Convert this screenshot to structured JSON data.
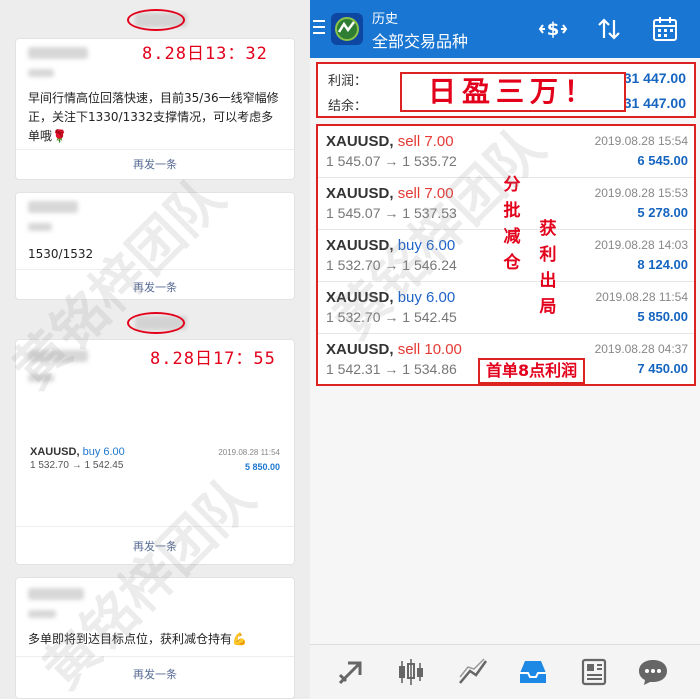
{
  "left_panel": {
    "cards": [
      {
        "timestamp": "8.28日13：32",
        "message": "早间行情高位回落快速，目前35/36一线窄幅修正，关注下1330/1332支撑情况，可以考虑多单哦🌹",
        "resend": "再发一条"
      },
      {
        "message": "1530/1532",
        "resend": "再发一条"
      },
      {
        "timestamp": "8.28日17：55",
        "trade": {
          "symbol": "XAUUSD,",
          "side": "buy 6.00",
          "date": "2019.08.28 11:54",
          "prices": "1 532.70 → 1 542.45",
          "profit": "5 850.00"
        },
        "resend": "再发一条"
      },
      {
        "message": "多单即将到达目标点位，获利减仓持有💪",
        "resend": "再发一条"
      }
    ]
  },
  "app": {
    "title_top": "历史",
    "title_main": "全部交易品种",
    "summary": {
      "profit_label": "利润：",
      "profit_value": "31 447.00",
      "balance_label": "结余：",
      "balance_value": "31 447.00",
      "overlay_text": "日盈三万！"
    },
    "trades": [
      {
        "symbol": "XAUUSD,",
        "side": "sell 7.00",
        "side_type": "sell",
        "prices": "1 545.07 → 1 535.72",
        "date": "2019.08.28 15:54",
        "profit": "6 545.00"
      },
      {
        "symbol": "XAUUSD,",
        "side": "sell 7.00",
        "side_type": "sell",
        "prices": "1 545.07 → 1 537.53",
        "date": "2019.08.28 15:53",
        "profit": "5 278.00"
      },
      {
        "symbol": "XAUUSD,",
        "side": "buy 6.00",
        "side_type": "buy",
        "prices": "1 532.70 → 1 546.24",
        "date": "2019.08.28 14:03",
        "profit": "8 124.00"
      },
      {
        "symbol": "XAUUSD,",
        "side": "buy 6.00",
        "side_type": "buy",
        "prices": "1 532.70 → 1 542.45",
        "date": "2019.08.28 11:54",
        "profit": "5 850.00"
      },
      {
        "symbol": "XAUUSD,",
        "side": "sell 10.00",
        "side_type": "sell",
        "prices": "1 542.31 → 1 534.86",
        "date": "2019.08.28 04:37",
        "profit": "7 450.00"
      }
    ],
    "annotations": {
      "col1": "分批减仓",
      "col2": "获利出局",
      "bottom": "首单8点利润"
    },
    "nav_icons": [
      "trade-arrow-icon",
      "candlestick-icon",
      "chart-line-icon",
      "inbox-icon",
      "news-icon",
      "chat-icon"
    ]
  },
  "watermark": "黄铭梓团队",
  "colors": {
    "accent": "#1976d2",
    "annotation_red": "#e3001b",
    "profit_blue": "#1565c0",
    "sell_red": "#e53935"
  }
}
